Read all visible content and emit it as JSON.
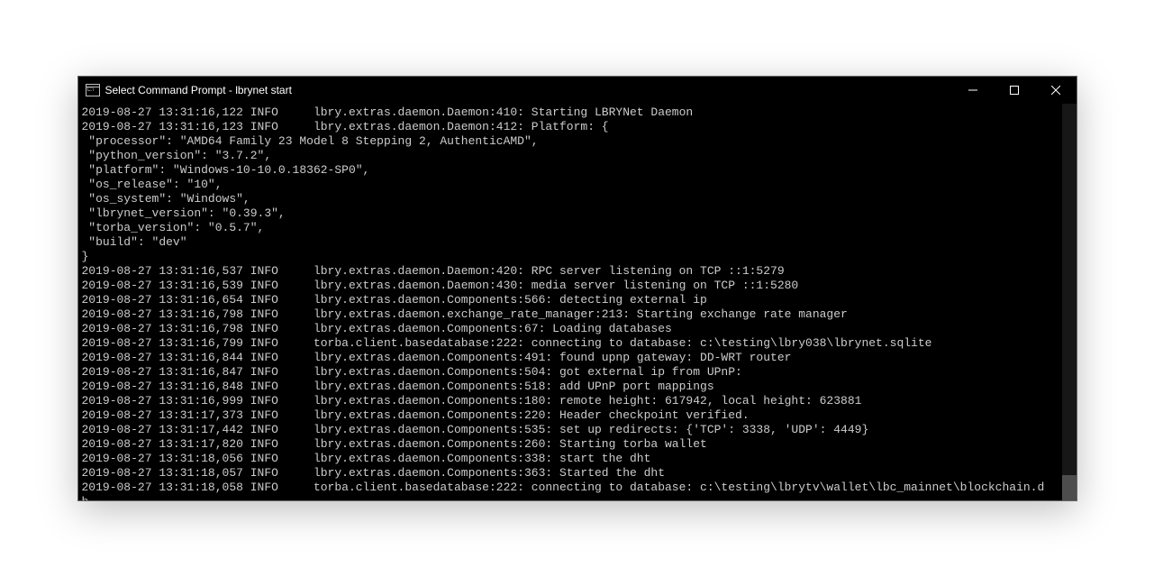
{
  "window": {
    "title": "Select Command Prompt - lbrynet  start"
  },
  "log_lines": [
    "2019-08-27 13:31:16,122 INFO     lbry.extras.daemon.Daemon:410: Starting LBRYNet Daemon",
    "2019-08-27 13:31:16,123 INFO     lbry.extras.daemon.Daemon:412: Platform: {",
    " \"processor\": \"AMD64 Family 23 Model 8 Stepping 2, AuthenticAMD\",",
    " \"python_version\": \"3.7.2\",",
    " \"platform\": \"Windows-10-10.0.18362-SP0\",",
    " \"os_release\": \"10\",",
    " \"os_system\": \"Windows\",",
    " \"lbrynet_version\": \"0.39.3\",",
    " \"torba_version\": \"0.5.7\",",
    " \"build\": \"dev\"",
    "}",
    "2019-08-27 13:31:16,537 INFO     lbry.extras.daemon.Daemon:420: RPC server listening on TCP ::1:5279",
    "2019-08-27 13:31:16,539 INFO     lbry.extras.daemon.Daemon:430: media server listening on TCP ::1:5280",
    "2019-08-27 13:31:16,654 INFO     lbry.extras.daemon.Components:566: detecting external ip",
    "2019-08-27 13:31:16,798 INFO     lbry.extras.daemon.exchange_rate_manager:213: Starting exchange rate manager",
    "2019-08-27 13:31:16,798 INFO     lbry.extras.daemon.Components:67: Loading databases",
    "2019-08-27 13:31:16,799 INFO     torba.client.basedatabase:222: connecting to database: c:\\testing\\lbry038\\lbrynet.sqlite",
    "2019-08-27 13:31:16,844 INFO     lbry.extras.daemon.Components:491: found upnp gateway: DD-WRT router",
    "2019-08-27 13:31:16,847 INFO     lbry.extras.daemon.Components:504: got external ip from UPnP:",
    "2019-08-27 13:31:16,848 INFO     lbry.extras.daemon.Components:518: add UPnP port mappings",
    "2019-08-27 13:31:16,999 INFO     lbry.extras.daemon.Components:180: remote height: 617942, local height: 623881",
    "2019-08-27 13:31:17,373 INFO     lbry.extras.daemon.Components:220: Header checkpoint verified.",
    "2019-08-27 13:31:17,442 INFO     lbry.extras.daemon.Components:535: set up redirects: {'TCP': 3338, 'UDP': 4449}",
    "2019-08-27 13:31:17,820 INFO     lbry.extras.daemon.Components:260: Starting torba wallet",
    "2019-08-27 13:31:18,056 INFO     lbry.extras.daemon.Components:338: start the dht",
    "2019-08-27 13:31:18,057 INFO     lbry.extras.daemon.Components:363: Started the dht",
    "2019-08-27 13:31:18,058 INFO     torba.client.basedatabase:222: connecting to database: c:\\testing\\lbrytv\\wallet\\lbc_mainnet\\blockchain.d",
    "b"
  ]
}
